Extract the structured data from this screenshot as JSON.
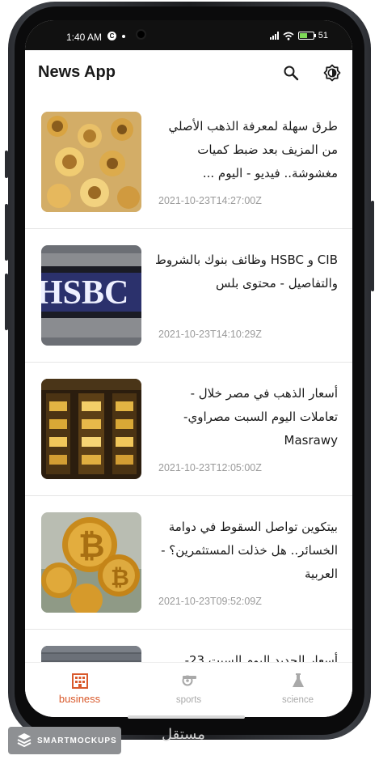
{
  "status_bar": {
    "time": "1:40 AM",
    "app_badge": "C",
    "battery": "51"
  },
  "app_bar": {
    "title": "News App",
    "search_icon": "search-icon",
    "theme_icon": "brightness-icon"
  },
  "articles": [
    {
      "headline": "طرق سهلة لمعرفة الذهب الأصلي من المزيف بعد ضبط كميات مغشوشة.. فيديو - اليوم ...",
      "date": "2021-10-23T14:27:00Z",
      "image": "gold-jewelry"
    },
    {
      "headline": "CIB و HSBC وظائف بنوك بالشروط والتفاصيل - محتوى بلس",
      "date": "2021-10-23T14:10:29Z",
      "image": "hsbc-sign"
    },
    {
      "headline": "أسعار الذهب في مصر خلال - تعاملات اليوم السبت مصراوي-Masrawy",
      "date": "2021-10-23T12:05:00Z",
      "image": "gold-shop"
    },
    {
      "headline": "بيتكوين تواصل السقوط في دوامة الخسائر.. هل خذلت المستثمرين؟ - العربية",
      "date": "2021-10-23T09:52:09Z",
      "image": "bitcoin-coins"
    },
    {
      "headline": "أسعار الحديد اليوم السبت 23-",
      "date": "",
      "image": "steel-bars"
    }
  ],
  "bottom_nav": {
    "tabs": [
      {
        "label": "business",
        "icon": "building-icon",
        "active": true
      },
      {
        "label": "sports",
        "icon": "whistle-icon",
        "active": false
      },
      {
        "label": "science",
        "icon": "flask-icon",
        "active": false
      }
    ]
  },
  "watermark": {
    "brand": "SMARTMOCKUPS",
    "site": "مستقل"
  },
  "colors": {
    "accent": "#d9592b",
    "inactive": "#a9a9a9",
    "date": "#9a9a9a"
  }
}
